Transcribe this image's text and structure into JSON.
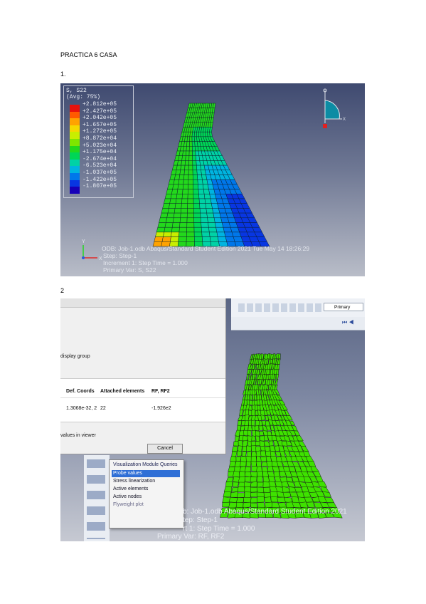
{
  "page": {
    "title": "PRACTICA 6 CASA",
    "section1": "1.",
    "section2": "2"
  },
  "figure1": {
    "legend_title": "S, S22",
    "legend_avg": "(Avg: 75%)",
    "legend_values": [
      "+2.812e+05",
      "+2.427e+05",
      "+2.042e+05",
      "+1.657e+05",
      "+1.272e+05",
      "+8.872e+04",
      "+5.023e+04",
      "+1.175e+04",
      "-2.674e+04",
      "-6.523e+04",
      "-1.037e+05",
      "-1.422e+05",
      "-1.807e+05"
    ],
    "legend_colors": [
      "#e8120c",
      "#ff5a00",
      "#ffa200",
      "#f5d800",
      "#c8ee00",
      "#7fe600",
      "#23d81c",
      "#00d656",
      "#00d2a6",
      "#00b4e0",
      "#0077ea",
      "#0836e2",
      "#1600b8"
    ],
    "odb_line": "ODB: Job-1.odb    Abaqus/Standard Student Edition 2021    Tue May 14 18:26:29",
    "step_line": "Step: Step-1",
    "increment_line": "Increment     1: Step Time =    1.000",
    "var_line": "Primary Var: S, S22",
    "axis_y": "Y",
    "axis_x": "X",
    "triad_x": "X"
  },
  "figure2": {
    "toolbar_text": "Primary",
    "dialog_display_group": "display group",
    "col_def_coords": "Def. Coords",
    "col_attached": "Attached elements",
    "col_rf": "RF, RF2",
    "val_def": "1.3068e-32, 2",
    "val_attached": "22",
    "val_rf": "-1.926e2",
    "values_in_viewer": "values in viewer",
    "cancel": "Cancel",
    "menu_title": "Visualization Module Queries",
    "menu_items": [
      "Probe values",
      "Stress linearization",
      "Active elements",
      "Active nodes",
      "Flyweight plot"
    ],
    "odb_line": "b: Job-1.odb    Abaqus/Standard Student Edition 2021",
    "step_line": "tep: Step-1",
    "increment_line": "rt     1: Step Time =    1.000",
    "var_line": "Primary Var: RF, RF2"
  }
}
